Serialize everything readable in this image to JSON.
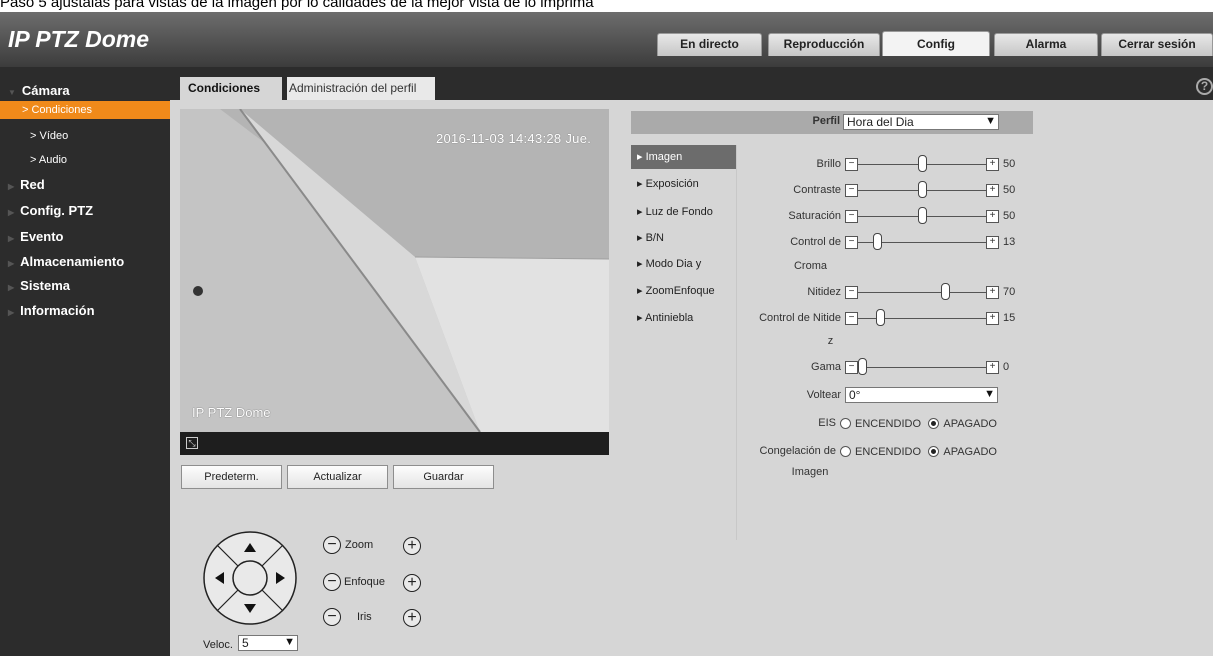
{
  "caption": "Paso 5 ajústalas para vistas de la imagen por lo calidades de la mejor vista de lo imprima",
  "app_title": "IP PTZ Dome",
  "nav_tabs": [
    {
      "label": "En directo"
    },
    {
      "label": "Reproducción"
    },
    {
      "label": "Config"
    },
    {
      "label": "Alarma"
    },
    {
      "label": "Cerrar sesión"
    }
  ],
  "active_nav": "Config",
  "sidebar": {
    "items": [
      {
        "label": "Cámara",
        "type": "category"
      },
      {
        "label": "> Condiciones",
        "type": "sub",
        "active": true
      },
      {
        "label": "> Vídeo",
        "type": "sub"
      },
      {
        "label": "> Audio",
        "type": "sub"
      },
      {
        "label": "Red",
        "type": "category"
      },
      {
        "label": "Config. PTZ",
        "type": "category"
      },
      {
        "label": "Evento",
        "type": "category"
      },
      {
        "label": "Almacenamiento",
        "type": "category"
      },
      {
        "label": "Sistema",
        "type": "category"
      },
      {
        "label": "Información",
        "type": "category"
      }
    ]
  },
  "subtabs": [
    {
      "label": "Condiciones",
      "active": true
    },
    {
      "label": "Administración del perfil",
      "active": false
    }
  ],
  "help_icon": "?",
  "video": {
    "timestamp": "2016-11-03 14:43:28 Jue.",
    "label": "IP PTZ Dome",
    "fullscreen_icon": "fullscreen-icon"
  },
  "buttons": {
    "default": "Predeterm.",
    "refresh": "Actualizar",
    "save": "Guardar"
  },
  "ptz": {
    "zoom": "Zoom",
    "focus": "Enfoque",
    "iris": "Iris",
    "speed_label": "Veloc.",
    "speed_value": "5"
  },
  "profile": {
    "label": "Perfil",
    "value": "Hora del Dia"
  },
  "menu": [
    {
      "label": "Imagen",
      "active": true
    },
    {
      "label": "Exposición"
    },
    {
      "label": "Luz de Fondo"
    },
    {
      "label": "B/N"
    },
    {
      "label": "Modo Dia y"
    },
    {
      "label": "ZoomEnfoque"
    },
    {
      "label": "Antiniebla"
    }
  ],
  "settings": {
    "brightness": {
      "label": "Brillo",
      "value": 50,
      "max": 100
    },
    "contrast": {
      "label": "Contraste",
      "value": 50,
      "max": 100
    },
    "saturation": {
      "label": "Saturación",
      "value": 50,
      "max": 100
    },
    "chroma": {
      "label_line1": "Control de",
      "label_line2": "Croma",
      "value": 13,
      "max": 100
    },
    "sharpness": {
      "label": "Nitidez",
      "value": 70,
      "max": 100
    },
    "sharpness_ctrl": {
      "label_line1": "Control de Nitide",
      "label_line2": "z",
      "value": 15,
      "max": 100
    },
    "gamma": {
      "label": "Gama",
      "value": 0,
      "max": 100
    },
    "flip": {
      "label": "Voltear",
      "value": "0°"
    },
    "eis": {
      "label": "EIS",
      "on": "ENCENDIDO",
      "off": "APAGADO",
      "selected": "off"
    },
    "freeze": {
      "label_line1": "Congelación de",
      "label_line2": "Imagen",
      "on": "ENCENDIDO",
      "off": "APAGADO",
      "selected": "off"
    }
  },
  "colors": {
    "accent": "#f08a1a",
    "sidebar_bg": "#2c2c2c",
    "header_bg": "#4e4e4e",
    "panel_bg": "#d6d6d6"
  }
}
